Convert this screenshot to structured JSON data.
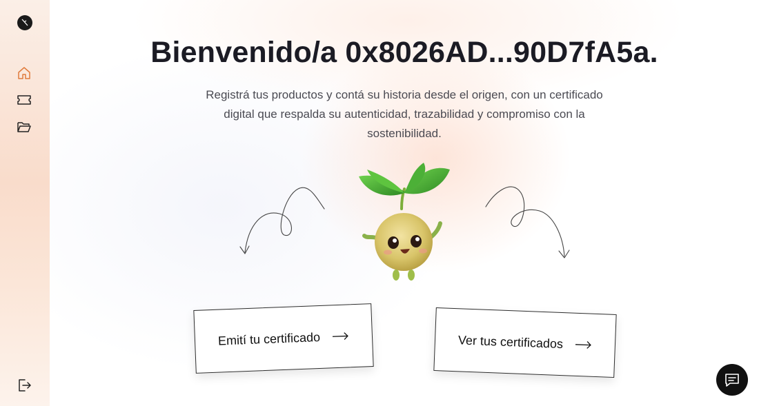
{
  "sidebar": {
    "logo_icon": "brand-logo-icon",
    "items": [
      {
        "icon": "home-icon",
        "active": true
      },
      {
        "icon": "ticket-icon",
        "active": false
      },
      {
        "icon": "folder-icon",
        "active": false
      }
    ],
    "logout_icon": "logout-icon"
  },
  "main": {
    "title": "Bienvenido/a 0x8026AD...90D7fA5a.",
    "subtitle": "Registrá tus productos y contá su historia desde el origen, con un certificado digital que respalda su autenticidad, trazabilidad y compromiso con la sostenibilidad.",
    "buttons": {
      "emit_label": "Emití tu certificado",
      "view_label": "Ver tus certificados"
    }
  },
  "chat": {
    "icon": "chat-icon"
  },
  "colors": {
    "accent": "#e07b3c",
    "text": "#1b1b24",
    "chat_bg": "#111111"
  }
}
